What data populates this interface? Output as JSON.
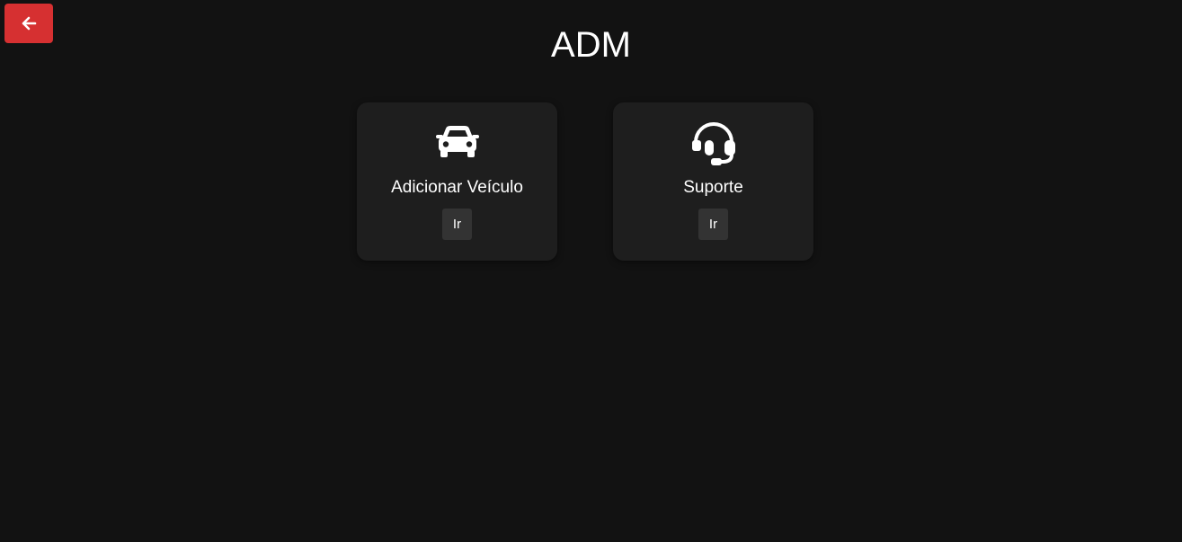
{
  "header": {
    "back_icon": "arrow-left-icon",
    "title": "ADM"
  },
  "colors": {
    "background": "#121212",
    "card": "#1e1e1e",
    "back_button": "#d63031",
    "card_button": "#333333",
    "text": "#ffffff"
  },
  "cards": [
    {
      "icon": "car-icon",
      "title": "Adicionar Veículo",
      "button_label": "Ir"
    },
    {
      "icon": "headset-icon",
      "title": "Suporte",
      "button_label": "Ir"
    }
  ]
}
